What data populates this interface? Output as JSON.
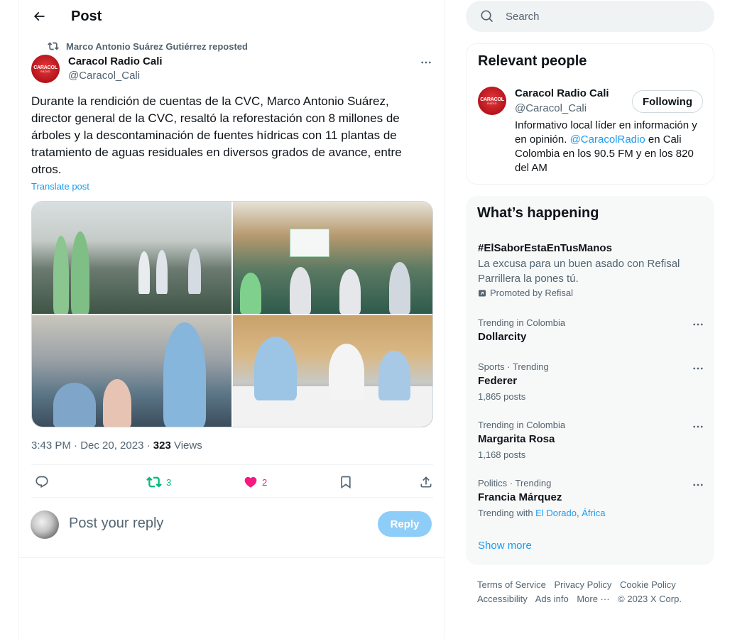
{
  "header": {
    "title": "Post"
  },
  "post": {
    "repost_text": "Marco Antonio Suárez Gutiérrez reposted",
    "author_name": "Caracol Radio Cali",
    "author_handle": "@Caracol_Cali",
    "avatar_logo": "CARACOL",
    "avatar_logo_sub": "RADIO",
    "text": "Durante la rendición de cuentas de la CVC, Marco Antonio Suárez, director general de la CVC, resaltó la reforestación con 8 millones de árboles y la descontaminación de fuentes hídricas con 11 plantas de tratamiento de aguas residuales en diversos grados de avance, entre otros.",
    "translate": "Translate post",
    "time": "3:43 PM · Dec 20, 2023 · ",
    "views_count": "323",
    "views_label": " Views",
    "reposts": "3",
    "likes": "2",
    "icons": {
      "reply": "reply-icon",
      "repost": "repost-icon",
      "like": "heart-icon",
      "bookmark": "bookmark-icon",
      "share": "share-icon"
    },
    "colors": {
      "repost": "#00ba7c",
      "like": "#f91880"
    }
  },
  "reply": {
    "placeholder": "Post your reply",
    "button": "Reply"
  },
  "search": {
    "placeholder": "Search"
  },
  "relevant_people": {
    "title": "Relevant people",
    "name": "Caracol Radio Cali",
    "handle": "@Caracol_Cali",
    "follow_label": "Following",
    "bio_part1": "Informativo local líder en información y en opinión. ",
    "bio_mention": "@CaracolRadio",
    "bio_part2": " en Cali Colombia en los 90.5 FM y en los 820 del AM"
  },
  "happening": {
    "title": "What’s happening",
    "promo": {
      "title": "#ElSaborEstaEnTusManos",
      "desc": "La excusa para un buen asado con Refisal Parrillera la pones tú.",
      "by": "Promoted by Refisal"
    },
    "trends": [
      {
        "meta": "Trending in Colombia",
        "title": "Dollarcity",
        "count": ""
      },
      {
        "meta": "Sports · Trending",
        "title": "Federer",
        "count": "1,865 posts"
      },
      {
        "meta": "Trending in Colombia",
        "title": "Margarita Rosa",
        "count": "1,168 posts"
      },
      {
        "meta": "Politics · Trending",
        "title": "Francia Márquez",
        "count": ""
      }
    ],
    "trend4_with": "Trending with ",
    "trend4_link1": "El Dorado",
    "trend4_sep": ", ",
    "trend4_link2": "África",
    "show_more": "Show more"
  },
  "footer": {
    "links": [
      "Terms of Service",
      "Privacy Policy",
      "Cookie Policy",
      "Accessibility",
      "Ads info",
      "More ···",
      "© 2023 X Corp."
    ]
  }
}
